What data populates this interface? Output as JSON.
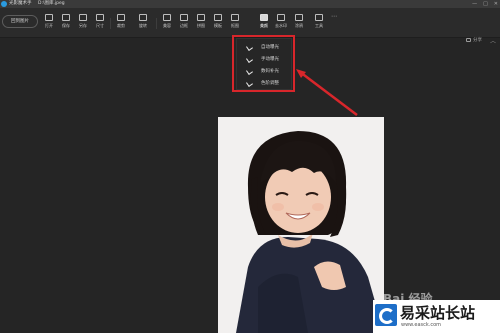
{
  "window": {
    "app_title": "光影魔术手",
    "file_path": "D:\\图库.jpeg",
    "controls": [
      "—",
      "□",
      "✕"
    ]
  },
  "toolbar": {
    "back_label": "回到图片",
    "tools": [
      {
        "label": "打开",
        "icon": "folder-icon"
      },
      {
        "label": "保存",
        "icon": "save-icon"
      },
      {
        "label": "另存",
        "icon": "save-as-icon"
      },
      {
        "label": "尺寸",
        "icon": "resize-icon"
      },
      {
        "label": "裁剪",
        "icon": "crop-icon"
      },
      {
        "label": "旋转",
        "icon": "rotate-icon"
      },
      {
        "label": "美容",
        "icon": "beauty-icon"
      },
      {
        "label": "边框",
        "icon": "frame-icon"
      },
      {
        "label": "拼图",
        "icon": "collage-icon"
      },
      {
        "label": "模板",
        "icon": "template-icon"
      },
      {
        "label": "抠图",
        "icon": "cutout-icon"
      },
      {
        "label": "美颜",
        "icon": "retouch-icon"
      },
      {
        "label": "去水印",
        "icon": "watermark-icon"
      },
      {
        "label": "涂鸦",
        "icon": "doodle-icon"
      },
      {
        "label": "工具",
        "icon": "tools-icon"
      }
    ],
    "more_glyph": "⋯"
  },
  "subbar": {
    "share_label": "分享",
    "collapse_glyph": "︿"
  },
  "dropdown": {
    "items": [
      {
        "label": "自动曝光",
        "icon": "auto-exposure-icon"
      },
      {
        "label": "手动曝光",
        "icon": "manual-exposure-icon"
      },
      {
        "label": "数码补光",
        "icon": "fill-light-icon"
      },
      {
        "label": "色阶调整",
        "icon": "levels-icon"
      }
    ]
  },
  "colors": {
    "annotation": "#d8262b",
    "background": "#252525",
    "toolbar": "#2b2b2b"
  },
  "watermark": {
    "site_name": "易采站长站",
    "site_url": "www.easck.com",
    "baidu": "Bai 经验"
  }
}
